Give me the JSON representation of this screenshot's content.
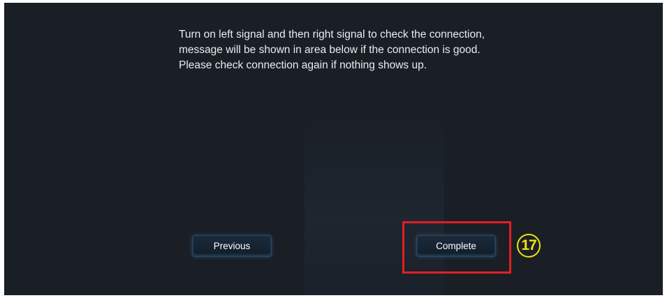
{
  "instructions": {
    "lines": [
      "Turn on left signal and then right signal to check the connection,",
      "message will be shown in area below if the connection is good.",
      "Please check connection again if nothing shows up."
    ]
  },
  "buttons": {
    "previous_label": "Previous",
    "complete_label": "Complete"
  },
  "annotation": {
    "step_number": "17",
    "highlight_color": "#e31e24",
    "callout_color": "#f3e10f"
  },
  "colors": {
    "screen_background": "#1a1f26",
    "text": "#e9ecef"
  }
}
